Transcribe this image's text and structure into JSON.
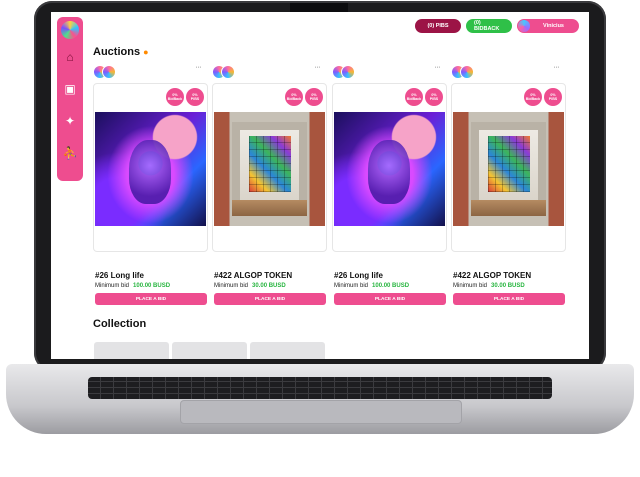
{
  "header": {
    "pibs_label": "(0) PIBS",
    "bidback_label": "(0) BIDBACK",
    "user_name": "Vinicius"
  },
  "sidebar": {
    "items": [
      {
        "icon": "home-icon",
        "glyph": "⌂",
        "active": true
      },
      {
        "icon": "gallery-icon",
        "glyph": "▣",
        "active": false
      },
      {
        "icon": "magic-wand-icon",
        "glyph": "✦",
        "active": false
      },
      {
        "icon": "runner-icon",
        "glyph": "⛹",
        "active": false
      }
    ]
  },
  "auctions": {
    "title": "Auctions",
    "more_glyph": "···",
    "cards": [
      {
        "name": "#26 Long life",
        "bid_label": "Minimum bid",
        "bid_value": "100.00 BUSD",
        "button": "PLACE A BID",
        "badge1_top": "0%",
        "badge1_bottom": "BidBack",
        "badge2_top": "0%",
        "badge2_bottom": "PIBS",
        "art": "cosmic"
      },
      {
        "name": "#422 ALGOP TOKEN",
        "bid_label": "Minimum bid",
        "bid_value": "30.00 BUSD",
        "button": "PLACE A BID",
        "badge1_top": "0%",
        "badge1_bottom": "BidBack",
        "badge2_top": "0%",
        "badge2_bottom": "PIBS",
        "art": "room"
      },
      {
        "name": "#26 Long life",
        "bid_label": "Minimum bid",
        "bid_value": "100.00 BUSD",
        "button": "PLACE A BID",
        "badge1_top": "0%",
        "badge1_bottom": "BidBack",
        "badge2_top": "0%",
        "badge2_bottom": "PIBS",
        "art": "cosmic"
      },
      {
        "name": "#422 ALGOP TOKEN",
        "bid_label": "Minimum bid",
        "bid_value": "30.00 BUSD",
        "button": "PLACE A BID",
        "badge1_top": "0%",
        "badge1_bottom": "BidBack",
        "badge2_top": "0%",
        "badge2_bottom": "PIBS",
        "art": "room"
      }
    ]
  },
  "collection": {
    "title": "Collection"
  },
  "colors": {
    "accent": "#ee4d8f",
    "pibs": "#9c1446",
    "bidback": "#2fc048",
    "bid_value": "#27b53f"
  }
}
